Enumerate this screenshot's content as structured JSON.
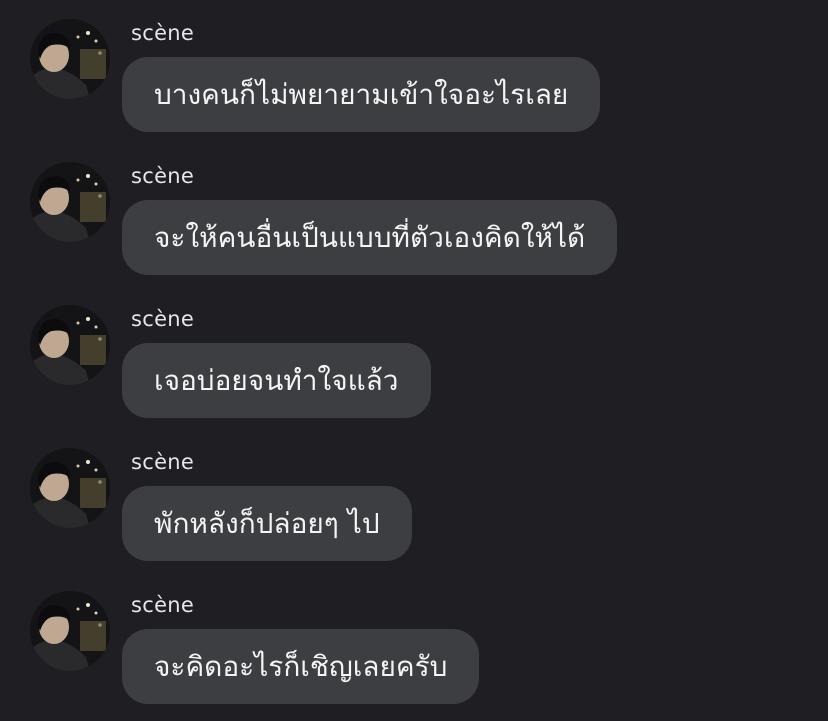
{
  "messages": [
    {
      "sender": "scène",
      "text": "บางคนก็ไม่พยายามเข้าใจอะไรเลย"
    },
    {
      "sender": "scène",
      "text": "จะให้คนอื่นเป็นแบบที่ตัวเองคิดให้ได้"
    },
    {
      "sender": "scène",
      "text": "เจอบ่อยจนทำใจแล้ว"
    },
    {
      "sender": "scène",
      "text": "พักหลังก็ปล่อยๆ ไป"
    },
    {
      "sender": "scène",
      "text": "จะคิดอะไรก็เชิญเลยครับ"
    }
  ]
}
